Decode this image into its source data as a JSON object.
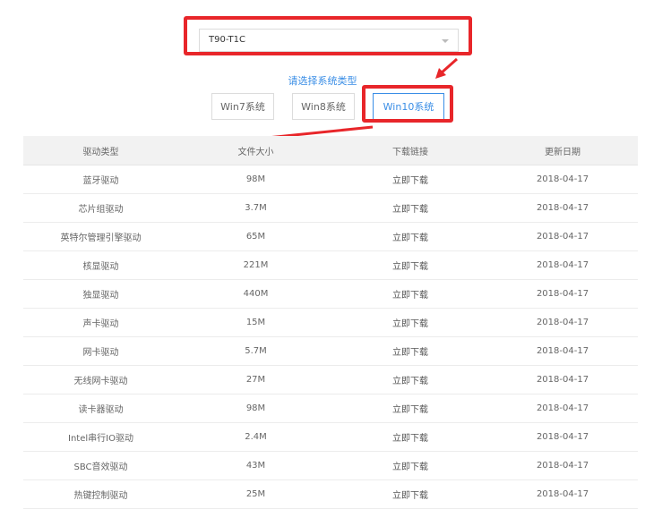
{
  "model_select": {
    "value": "T90-T1C"
  },
  "system_prompt": "请选择系统类型",
  "system_buttons": [
    {
      "label": "Win7系统"
    },
    {
      "label": "Win8系统"
    },
    {
      "label": "Win10系统"
    }
  ],
  "selected_system": "Win10系统",
  "table": {
    "headers": [
      "驱动类型",
      "文件大小",
      "下载链接",
      "更新日期"
    ],
    "rows": [
      [
        "蓝牙驱动",
        "98M",
        "立即下载",
        "2018-04-17"
      ],
      [
        "芯片组驱动",
        "3.7M",
        "立即下载",
        "2018-04-17"
      ],
      [
        "英特尔管理引擎驱动",
        "65M",
        "立即下载",
        "2018-04-17"
      ],
      [
        "核显驱动",
        "221M",
        "立即下载",
        "2018-04-17"
      ],
      [
        "独显驱动",
        "440M",
        "立即下载",
        "2018-04-17"
      ],
      [
        "声卡驱动",
        "15M",
        "立即下载",
        "2018-04-17"
      ],
      [
        "网卡驱动",
        "5.7M",
        "立即下载",
        "2018-04-17"
      ],
      [
        "无线网卡驱动",
        "27M",
        "立即下载",
        "2018-04-17"
      ],
      [
        "读卡器驱动",
        "98M",
        "立即下载",
        "2018-04-17"
      ],
      [
        "Intel串行IO驱动",
        "2.4M",
        "立即下载",
        "2018-04-17"
      ],
      [
        "SBC音效驱动",
        "43M",
        "立即下载",
        "2018-04-17"
      ],
      [
        "热键控制驱动",
        "25M",
        "立即下载",
        "2018-04-17"
      ]
    ]
  },
  "colors": {
    "annotation": "#e8262a",
    "accent": "#3a8ee6",
    "header_bg": "#f2f2f2"
  }
}
